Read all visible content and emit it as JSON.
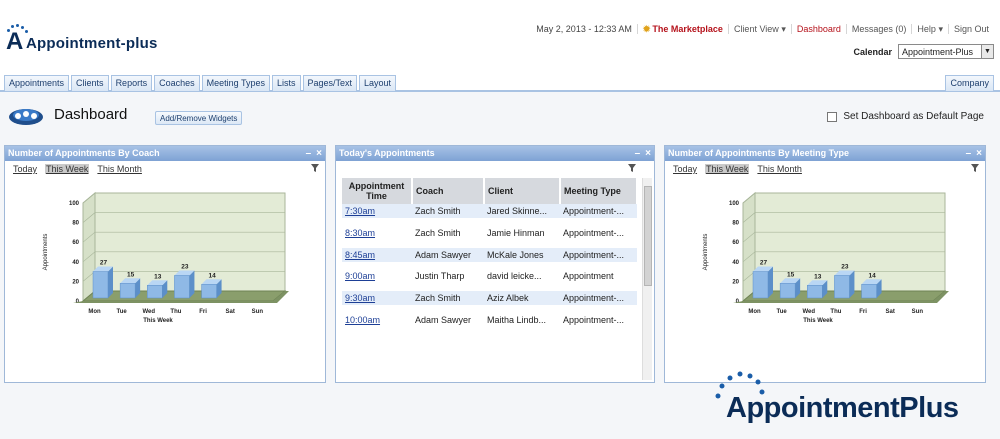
{
  "header": {
    "logo_text": "Appointment-plus",
    "date": "May 2, 2013 - 12:33 AM",
    "marketplace": "The Marketplace",
    "client_view": "Client View",
    "dashboard": "Dashboard",
    "messages": "Messages (0)",
    "help": "Help",
    "sign_out": "Sign Out",
    "calendar_label": "Calendar",
    "calendar_value": "Appointment-Plus"
  },
  "nav": {
    "tabs": [
      "Appointments",
      "Clients",
      "Reports",
      "Coaches",
      "Meeting Types",
      "Lists",
      "Pages/Text",
      "Layout"
    ],
    "right_tab": "Company"
  },
  "page": {
    "title": "Dashboard",
    "widgets_button": "Add/Remove Widgets",
    "default_page_label": "Set Dashboard as Default Page"
  },
  "filters": [
    "Today",
    "This Week",
    "This Month"
  ],
  "panels": {
    "coach": {
      "title": "Number of Appointments By Coach"
    },
    "today": {
      "title": "Today's Appointments"
    },
    "meeting_type": {
      "title": "Number of Appointments By Meeting Type"
    }
  },
  "appointments": {
    "headers": [
      "Appointment Time",
      "Coach",
      "Client",
      "Meeting Type"
    ],
    "rows": [
      {
        "time": "7:30am",
        "coach": "Zach Smith",
        "client": "Jared Skinne...",
        "type": "Appointment-..."
      },
      {
        "time": "8:30am",
        "coach": "Zach Smith",
        "client": "Jamie Hinman",
        "type": "Appointment-..."
      },
      {
        "time": "8:45am",
        "coach": "Adam Sawyer",
        "client": "McKale Jones",
        "type": "Appointment-..."
      },
      {
        "time": "9:00am",
        "coach": "Justin Tharp",
        "client": "david leicke...",
        "type": "Appointment"
      },
      {
        "time": "9:30am",
        "coach": "Zach Smith",
        "client": "Aziz Albek",
        "type": "Appointment-..."
      },
      {
        "time": "10:00am",
        "coach": "Adam Sawyer",
        "client": "Maitha Lindb...",
        "type": "Appointment-..."
      }
    ]
  },
  "chart_data": [
    {
      "type": "bar",
      "categories": [
        "Mon",
        "Tue",
        "Wed",
        "Thu",
        "Fri",
        "Sat",
        "Sun"
      ],
      "values": [
        27,
        15,
        13,
        23,
        14,
        0,
        0
      ],
      "xlabel": "This Week",
      "ylabel": "Appointments",
      "yticks": [
        0,
        20,
        40,
        60,
        80,
        100
      ],
      "ylim": [
        0,
        100
      ],
      "color": "#8fb9e6"
    },
    {
      "type": "bar",
      "categories": [
        "Mon",
        "Tue",
        "Wed",
        "Thu",
        "Fri",
        "Sat",
        "Sun"
      ],
      "values": [
        27,
        15,
        13,
        23,
        14,
        0,
        0
      ],
      "xlabel": "This Week",
      "ylabel": "Appointments",
      "yticks": [
        0,
        20,
        40,
        60,
        80,
        100
      ],
      "ylim": [
        0,
        100
      ],
      "color": "#8fb9e6"
    }
  ],
  "watermark": {
    "text": "AppointmentPlus"
  },
  "colors": {
    "accent_red": "#b5121b",
    "panel_head": "#8fb0dc",
    "brand_navy": "#0b2c57"
  }
}
